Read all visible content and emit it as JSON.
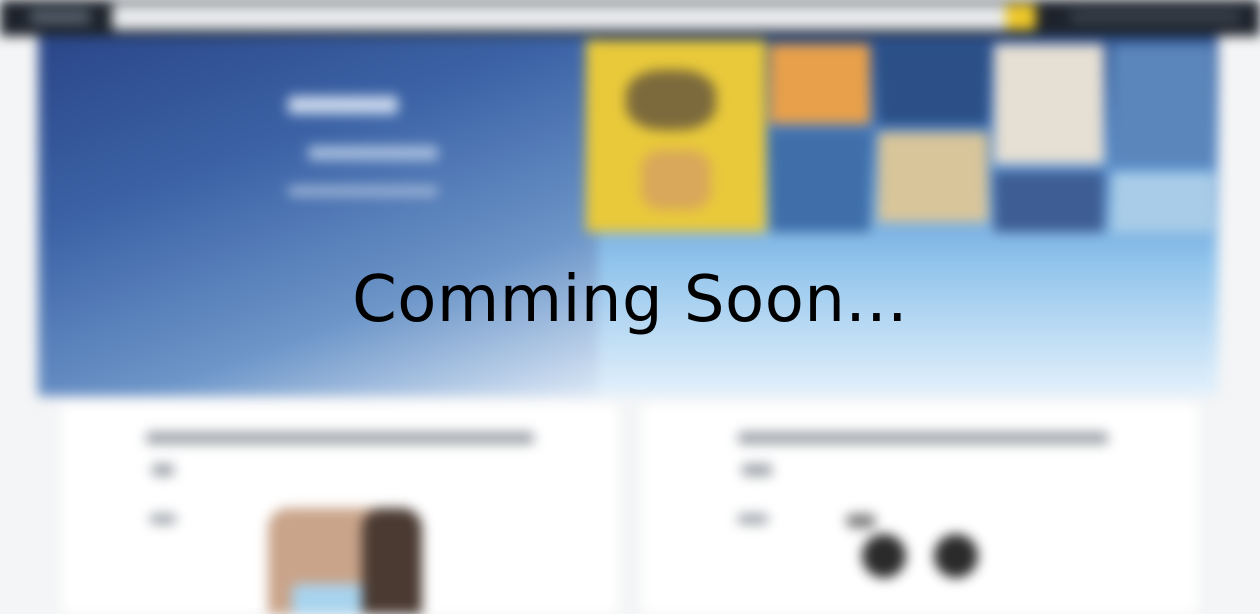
{
  "overlay": {
    "message": "Comming Soon..."
  },
  "colors": {
    "topbar": "#1d232c",
    "search_button": "#efc92a",
    "hero_top": "#2c4f8f",
    "hero_bottom": "#e4f1fb"
  },
  "icons": [
    "search-icon"
  ]
}
